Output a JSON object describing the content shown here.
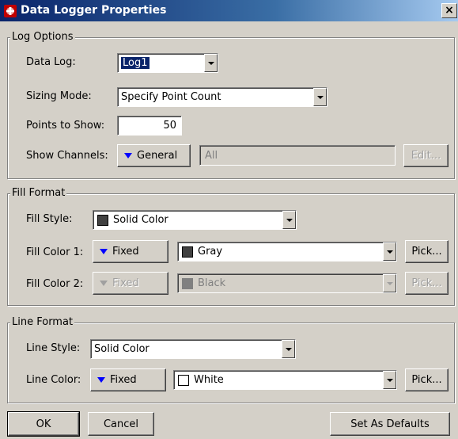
{
  "window": {
    "title": "Data Logger Properties",
    "close_label": "×"
  },
  "log_options": {
    "legend": "Log Options",
    "data_log": {
      "label": "Data Log:",
      "value": "Log1"
    },
    "sizing_mode": {
      "label": "Sizing Mode:",
      "value": "Specify Point Count"
    },
    "points_to_show": {
      "label": "Points to Show:",
      "value": "50"
    },
    "show_channels": {
      "label": "Show Channels:",
      "button": "General",
      "field_value": "All",
      "edit_button": "Edit..."
    }
  },
  "fill_format": {
    "legend": "Fill Format",
    "fill_style": {
      "label": "Fill Style:",
      "value": "Solid Color",
      "swatch_color": "#404040"
    },
    "fill_color_1": {
      "label": "Fill Color 1:",
      "mode": "Fixed",
      "value": "Gray",
      "swatch_color": "#404040",
      "pick": "Pick..."
    },
    "fill_color_2": {
      "label": "Fill Color 2:",
      "mode": "Fixed",
      "value": "Black",
      "swatch_color": "#808080",
      "pick": "Pick..."
    }
  },
  "line_format": {
    "legend": "Line Format",
    "line_style": {
      "label": "Line Style:",
      "value": "Solid Color"
    },
    "line_color": {
      "label": "Line Color:",
      "mode": "Fixed",
      "value": "White",
      "swatch_color": "#ffffff",
      "pick": "Pick..."
    }
  },
  "footer": {
    "ok": "OK",
    "cancel": "Cancel",
    "set_defaults": "Set As Defaults"
  }
}
